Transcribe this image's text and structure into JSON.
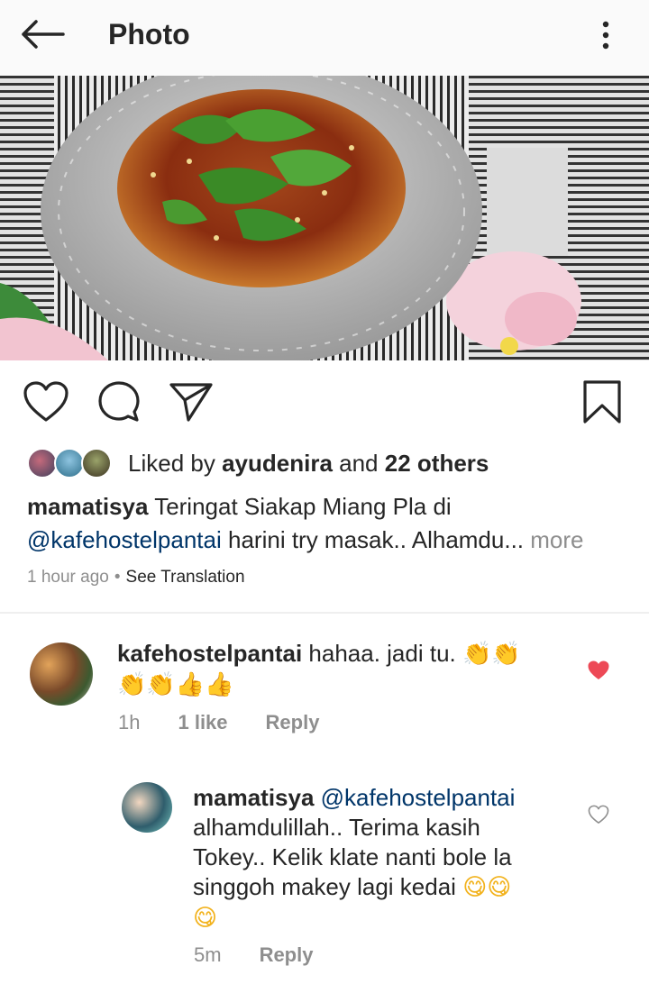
{
  "header": {
    "title": "Photo",
    "back_icon": "arrow-left-icon",
    "more_icon": "more-vertical-icon"
  },
  "post": {
    "liked_by_prefix": "Liked by",
    "liked_by_user": "ayudenira",
    "liked_by_and": "and",
    "liked_by_others": "22 others",
    "caption_user": "mamatisya",
    "caption_line1": "Teringat Siakap Miang Pla di",
    "caption_mention": "@kafehostelpantai",
    "caption_line2": "harini try masak.. Alhamdu...",
    "caption_more": "more",
    "time": "1 hour ago",
    "separator": "•",
    "see_translation": "See Translation"
  },
  "comments": [
    {
      "user": "kafehostelpantai",
      "text": "hahaa.  jadi tu.",
      "emojis_line1": "👏👏",
      "emojis_line2": "👏👏👍👍",
      "time": "1h",
      "likes": "1 like",
      "reply": "Reply",
      "liked": true
    },
    {
      "user": "mamatisya",
      "mention": "@kafehostelpantai",
      "line1": "alhamdulillah.. Terima kasih",
      "line2": "Tokey.. Kelik klate nanti bole la",
      "line3": "singgoh makey lagi kedai",
      "emoji_end": "😋😋",
      "emoji_line": "😋",
      "time": "5m",
      "reply": "Reply",
      "liked": false
    }
  ],
  "colors": {
    "text": "#262626",
    "muted": "#8e8e8e",
    "mention": "#003569",
    "like_red": "#ed4956",
    "topbar_bg": "#fafafa"
  }
}
